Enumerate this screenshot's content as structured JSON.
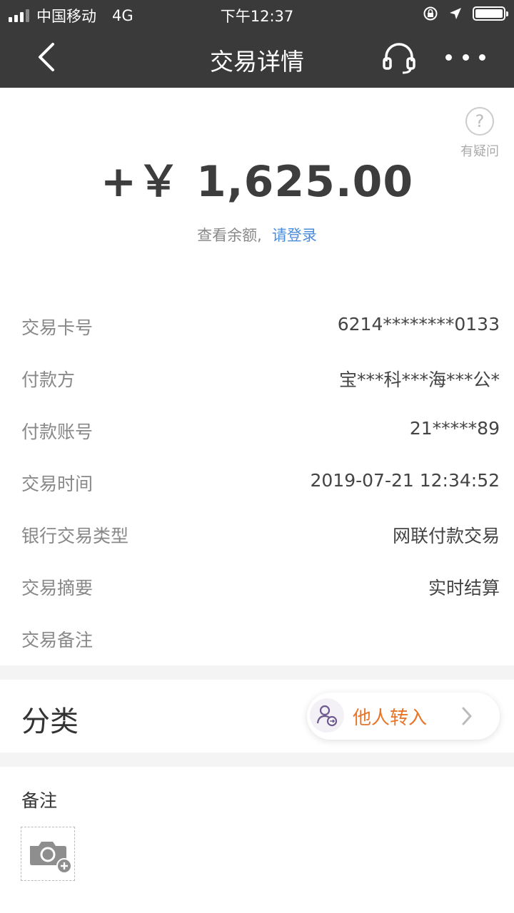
{
  "status_bar": {
    "carrier": "中国移动",
    "network": "4G",
    "time": "下午12:37"
  },
  "nav": {
    "title": "交易详情",
    "back_icon": "chevron-left-icon",
    "service_icon": "headset-icon",
    "more_icon": "more-dots-icon"
  },
  "help": {
    "icon": "question-circle-icon",
    "label": "有疑问"
  },
  "amount": "+￥ 1,625.00",
  "balance": {
    "text": "查看余额,",
    "login_link": "请登录"
  },
  "details": [
    {
      "key": "交易卡号",
      "value": "6214********0133"
    },
    {
      "key": "付款方",
      "value": "宝***科***海***公*"
    },
    {
      "key": "付款账号",
      "value": "21*****89"
    },
    {
      "key": "交易时间",
      "value": "2019-07-21 12:34:52"
    },
    {
      "key": "银行交易类型",
      "value": "网联付款交易"
    },
    {
      "key": "交易摘要",
      "value": "实时结算"
    },
    {
      "key": "交易备注",
      "value": ""
    }
  ],
  "category": {
    "label": "分类",
    "selected": "他人转入",
    "icon": "person-transfer-icon"
  },
  "note": {
    "label": "备注",
    "add_photo_icon": "camera-add-icon"
  },
  "colors": {
    "header_bg": "#3a3a3a",
    "link": "#4a8ddb",
    "category_accent": "#e8752a"
  }
}
